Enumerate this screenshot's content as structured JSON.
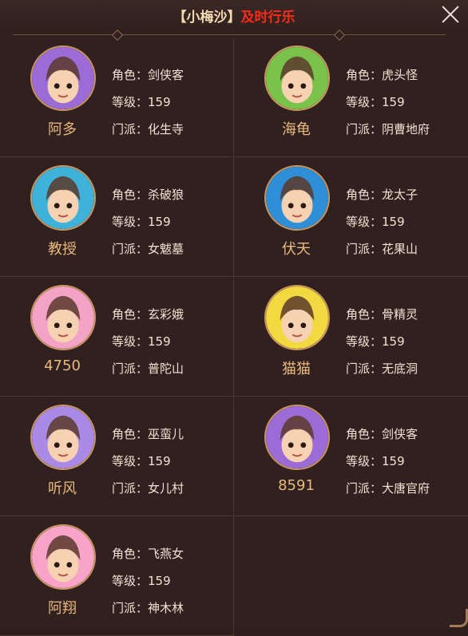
{
  "window": {
    "title_prefix": "【小梅沙】",
    "title_highlight": "及时行乐"
  },
  "labels": {
    "role": "角色：",
    "level": "等级：",
    "sect": "门派："
  },
  "players": [
    {
      "name": "阿多",
      "role": "剑侠客",
      "level": "159",
      "sect": "化生寺",
      "avatar": "jianxiake-avatar",
      "bg": "#9b6bd6"
    },
    {
      "name": "海龟",
      "role": "虎头怪",
      "level": "159",
      "sect": "阴曹地府",
      "avatar": "hutouguai-avatar",
      "bg": "#7ac34a"
    },
    {
      "name": "教授",
      "role": "杀破狼",
      "level": "159",
      "sect": "女魃墓",
      "avatar": "shapolang-avatar",
      "bg": "#3fb2d9"
    },
    {
      "name": "伏天",
      "role": "龙太子",
      "level": "159",
      "sect": "花果山",
      "avatar": "longtaizi-avatar",
      "bg": "#2f8fd6"
    },
    {
      "name": "4750",
      "role": "玄彩娥",
      "level": "159",
      "sect": "普陀山",
      "avatar": "xuancaie-avatar",
      "bg": "#f3a3c6"
    },
    {
      "name": "猫猫",
      "role": "骨精灵",
      "level": "159",
      "sect": "无底洞",
      "avatar": "gujingling-avatar",
      "bg": "#f2d940"
    },
    {
      "name": "听风",
      "role": "巫蛮儿",
      "level": "159",
      "sect": "女儿村",
      "avatar": "wumaner-avatar",
      "bg": "#a98ae6"
    },
    {
      "name": "8591",
      "role": "剑侠客",
      "level": "159",
      "sect": "大唐官府",
      "avatar": "jianxiake-avatar",
      "bg": "#9b6bd6"
    },
    {
      "name": "阿翔",
      "role": "飞燕女",
      "level": "159",
      "sect": "神木林",
      "avatar": "feiyannv-avatar",
      "bg": "#f7a4c8"
    }
  ]
}
